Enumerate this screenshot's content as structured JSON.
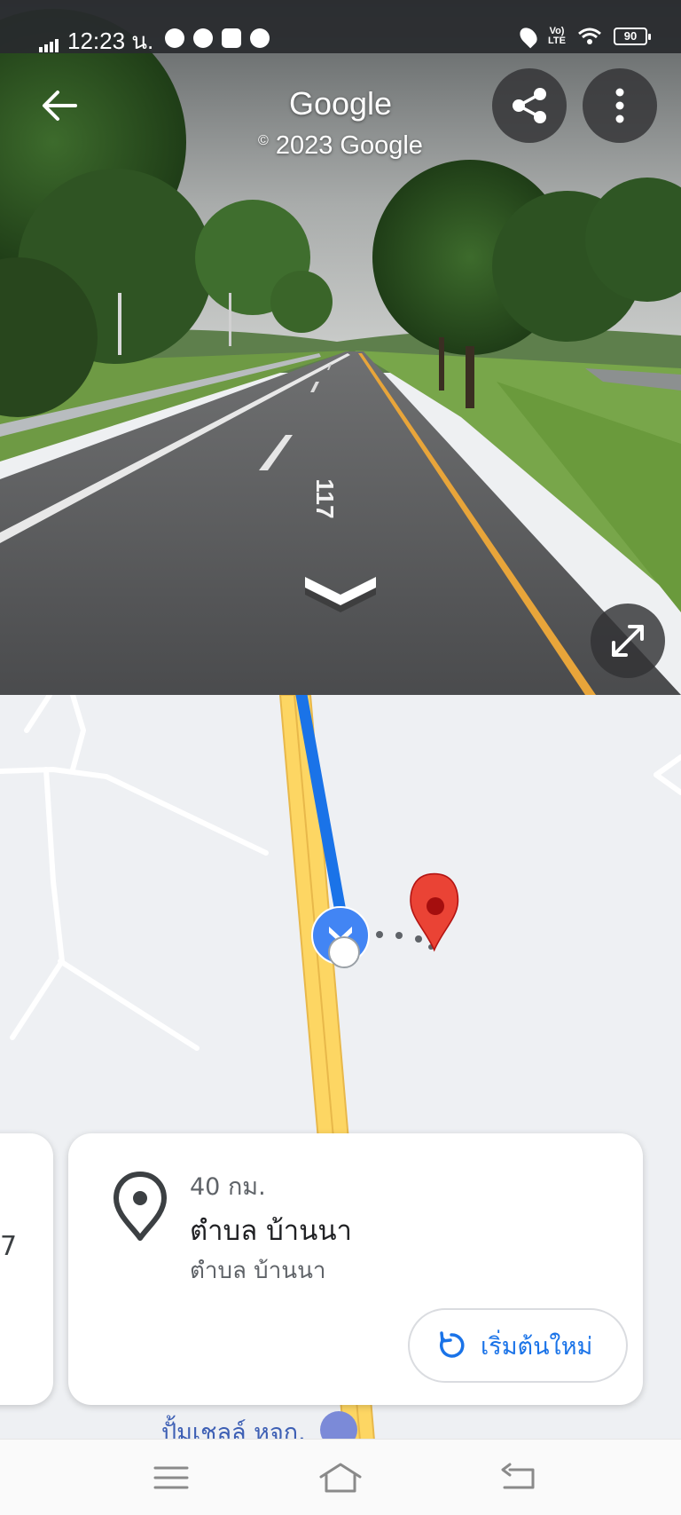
{
  "status_bar": {
    "time": "12:23 น.",
    "network": "LTE",
    "battery": "90",
    "app_icons": [
      "line-icon",
      "messenger-icon",
      "youtube-icon",
      "message-icon"
    ]
  },
  "header": {
    "title": "Google",
    "copyright_symbol": "©",
    "copyright_text": "2023 Google"
  },
  "street_view": {
    "road_marking": "117",
    "buttons": [
      "back-arrow-icon",
      "share-icon",
      "more-vert-icon",
      "expand-icon"
    ]
  },
  "map": {
    "route_color": "#1a73e8",
    "road_color": "#fdd663",
    "destination_pin_color": "#ea4335",
    "poi_label": "ปั้มเชลล์ หจก."
  },
  "left_card": {
    "number": "7"
  },
  "place_card": {
    "distance": "40 กม.",
    "title": "ตำบล บ้านนา",
    "subtitle": "ตำบล บ้านนา",
    "restart_label": "เริ่มต้นใหม่"
  },
  "colors": {
    "accent": "#1a73e8",
    "pin_red": "#ea4335"
  }
}
